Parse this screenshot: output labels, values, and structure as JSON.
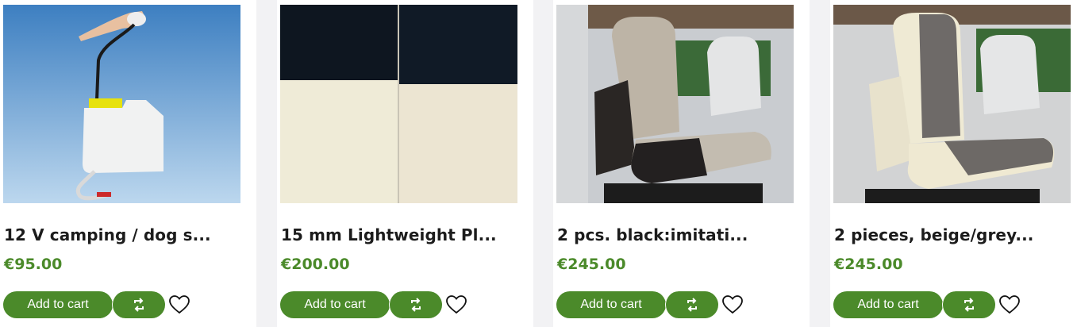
{
  "products": [
    {
      "title": "12 V camping / dog s...",
      "price": "€95.00",
      "add_to_cart": "Add to cart",
      "compare_icon": "compare-arrows-icon",
      "wishlist_icon": "heart-outline-icon"
    },
    {
      "title": "15 mm Lightweight Pl...",
      "price": "€200.00",
      "add_to_cart": "Add to cart",
      "compare_icon": "compare-arrows-icon",
      "wishlist_icon": "heart-outline-icon"
    },
    {
      "title": "2 pcs. black:imitati...",
      "price": "€245.00",
      "add_to_cart": "Add to cart",
      "compare_icon": "compare-arrows-icon",
      "wishlist_icon": "heart-outline-icon"
    },
    {
      "title": "2 pieces, beige/grey...",
      "price": "€245.00",
      "add_to_cart": "Add to cart",
      "compare_icon": "compare-arrows-icon",
      "wishlist_icon": "heart-outline-icon"
    }
  ],
  "colors": {
    "accent": "#4b8a2a",
    "price": "#4b8a2a",
    "title": "#1c1c1c",
    "background": "#f2f2f4",
    "card": "#ffffff"
  }
}
